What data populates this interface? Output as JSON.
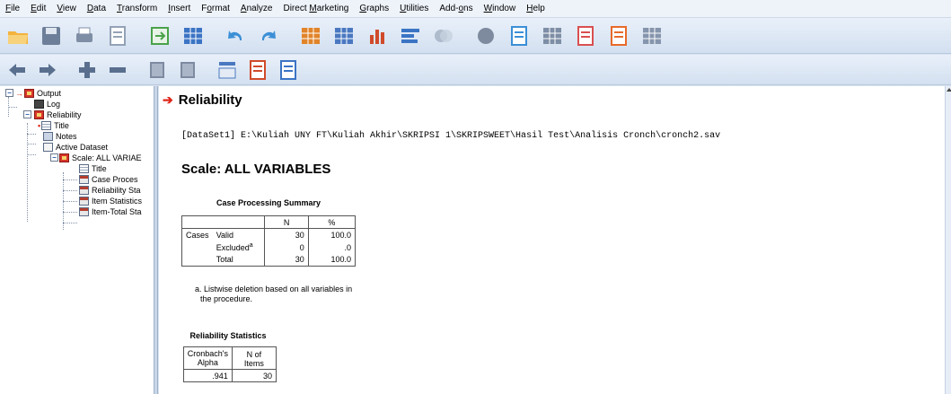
{
  "menu": [
    {
      "label": "File",
      "key": "F"
    },
    {
      "label": "Edit",
      "key": "E"
    },
    {
      "label": "View",
      "key": "V"
    },
    {
      "label": "Data",
      "key": "D"
    },
    {
      "label": "Transform",
      "key": "T"
    },
    {
      "label": "Insert",
      "key": "I"
    },
    {
      "label": "Format",
      "key": "o"
    },
    {
      "label": "Analyze",
      "key": "A"
    },
    {
      "label": "Direct Marketing",
      "key": "M"
    },
    {
      "label": "Graphs",
      "key": "G"
    },
    {
      "label": "Utilities",
      "key": "U"
    },
    {
      "label": "Add-ons",
      "key": "o"
    },
    {
      "label": "Window",
      "key": "W"
    },
    {
      "label": "Help",
      "key": "H"
    }
  ],
  "toolbar1": [
    "open-folder-icon",
    "save-icon",
    "print-icon",
    "print-preview-icon",
    "recall-dialog-icon",
    "goto-data-icon",
    "undo-icon",
    "redo-icon",
    "goto-case-icon",
    "goto-variable-icon",
    "insert-cases-icon",
    "insert-variable-icon",
    "split-file-icon",
    "weight-cases-icon",
    "value-labels-icon",
    "use-sets-icon",
    "show-all-variables-icon",
    "spelling-icon",
    "designate-window-icon"
  ],
  "toolbar2": [
    "promote-icon",
    "demote-icon",
    "expand-icon",
    "collapse-icon",
    "show-icon",
    "hide-icon",
    "insert-heading-icon",
    "insert-title-icon",
    "insert-text-icon"
  ],
  "nav": {
    "output": "Output",
    "log": "Log",
    "reliability": "Reliability",
    "title": "Title",
    "notes": "Notes",
    "active_dataset": "Active Dataset",
    "scale": "Scale: ALL VARIAE",
    "scale_title": "Title",
    "case_processing": "Case Proces",
    "reliability_stats": "Reliability Sta",
    "item_statistics": "Item Statistics",
    "item_total": "Item-Total Sta"
  },
  "content": {
    "heading": "Reliability",
    "dataset_line": "[DataSet1] E:\\Kuliah UNY FT\\Kuliah Akhir\\SKRIPSI 1\\SKRIPSWEET\\Hasil Test\\Analisis Cronch\\cronch2.sav",
    "scale_title": "Scale: ALL VARIABLES",
    "case_table": {
      "title": "Case Processing Summary",
      "col_n": "N",
      "col_pct": "%",
      "group": "Cases",
      "rows": [
        {
          "label": "Valid",
          "n": "30",
          "pct": "100.0"
        },
        {
          "label": "Excluded",
          "sup": "a",
          "n": "0",
          "pct": ".0"
        },
        {
          "label": "Total",
          "n": "30",
          "pct": "100.0"
        }
      ],
      "footnote_a": "a. Listwise deletion based on all variables in",
      "footnote_b": "the procedure."
    },
    "rel_table": {
      "title": "Reliability Statistics",
      "col_alpha_1": "Cronbach's",
      "col_alpha_2": "Alpha",
      "col_items": "N of Items",
      "alpha": ".941",
      "items": "30"
    }
  }
}
